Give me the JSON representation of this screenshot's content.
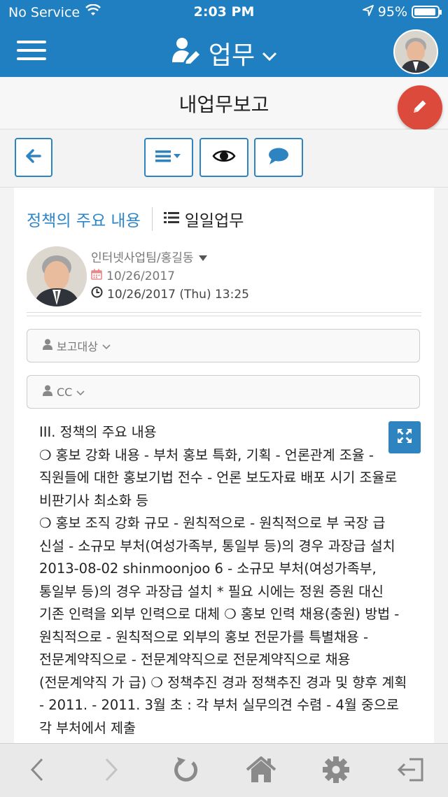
{
  "status_bar": {
    "carrier": "No Service",
    "time": "2:03 PM",
    "battery_percent": "95%",
    "battery_level": 0.95
  },
  "app_bar": {
    "title": "업무",
    "color": "#1f7fc1"
  },
  "page": {
    "title": "내업무보고"
  },
  "toolbar": {
    "buttons": [
      "back-arrow-icon",
      "list-dropdown-icon",
      "eye-icon",
      "comment-icon"
    ]
  },
  "report": {
    "heading": "정책의 주요 내용",
    "category": "일일업무",
    "author": "인터넷사업팀/홍길동",
    "date": "10/26/2017",
    "datetime": "10/26/2017 (Thu) 13:25",
    "recipients_label": "보고대상",
    "cc_label": "CC",
    "body": [
      "III. 정책의 주요 내용",
      "❍ 홍보 강화 내용 - 부처 홍보 특화, 기획 - 언론관계 조율 - 직원들에 대한 홍보기법 전수 - 언론 보도자료 배포 시기 조율로 비판기사 최소화 등",
      "❍ 홍보 조직 강화 규모 - 원칙적으로 - 원칙적으로 부 국장 급 신설 - 소규모 부처(여성가족부, 통일부 등)의 경우 과장급 설치",
      "2013-08-02 shinmoonjoo 6 - 소규모 부처(여성가족부, 통일부 등)의 경우 과장급 설치 * 필요 시에는 정원 증원 대신 기존 인력을 외부 인력으로 대체 ❍ 홍보 인력 채용(충원) 방법 - 원칙적으로 - 원칙적으로 외부의 홍보 전문가를 특별채용 - 전문계약직으로 - 전문계약직으로 전문계약직으로 채용(전문계약직 가 급) ❍ 정책추진 경과 정책추진 경과 및 향후 계획 - 2011. - 2011. 3월 초 : 각 부처 실무의견 수렴 - 4월 중으로 각 부처에서 제출"
    ]
  },
  "bottom_nav": {
    "items": [
      "back-icon",
      "forward-icon",
      "refresh-icon",
      "home-icon",
      "settings-icon",
      "logout-icon"
    ]
  }
}
